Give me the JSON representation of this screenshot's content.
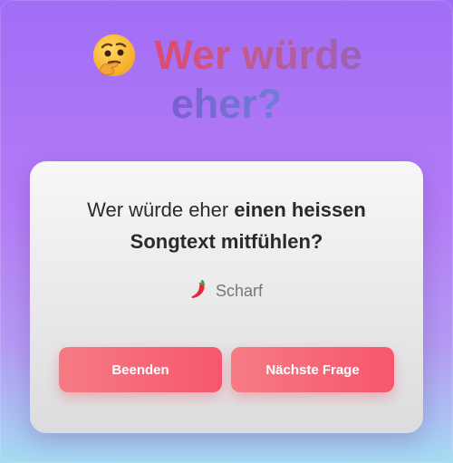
{
  "header": {
    "emoji_icon": "thinking-face-icon",
    "title_line1": "Wer würde",
    "title_line2": "eher?"
  },
  "card": {
    "question_prefix": "Wer würde eher ",
    "question_bold": "einen heissen Songtext mitfühlen?",
    "level_icon": "chili-pepper-icon",
    "level_label": "Scharf"
  },
  "actions": {
    "end_label": "Beenden",
    "next_label": "Nächste Frage"
  },
  "colors": {
    "button_start": "#f67b83",
    "button_end": "#f6566d",
    "title_red": "#e04a6e",
    "title_purple": "#7b5fd0"
  }
}
